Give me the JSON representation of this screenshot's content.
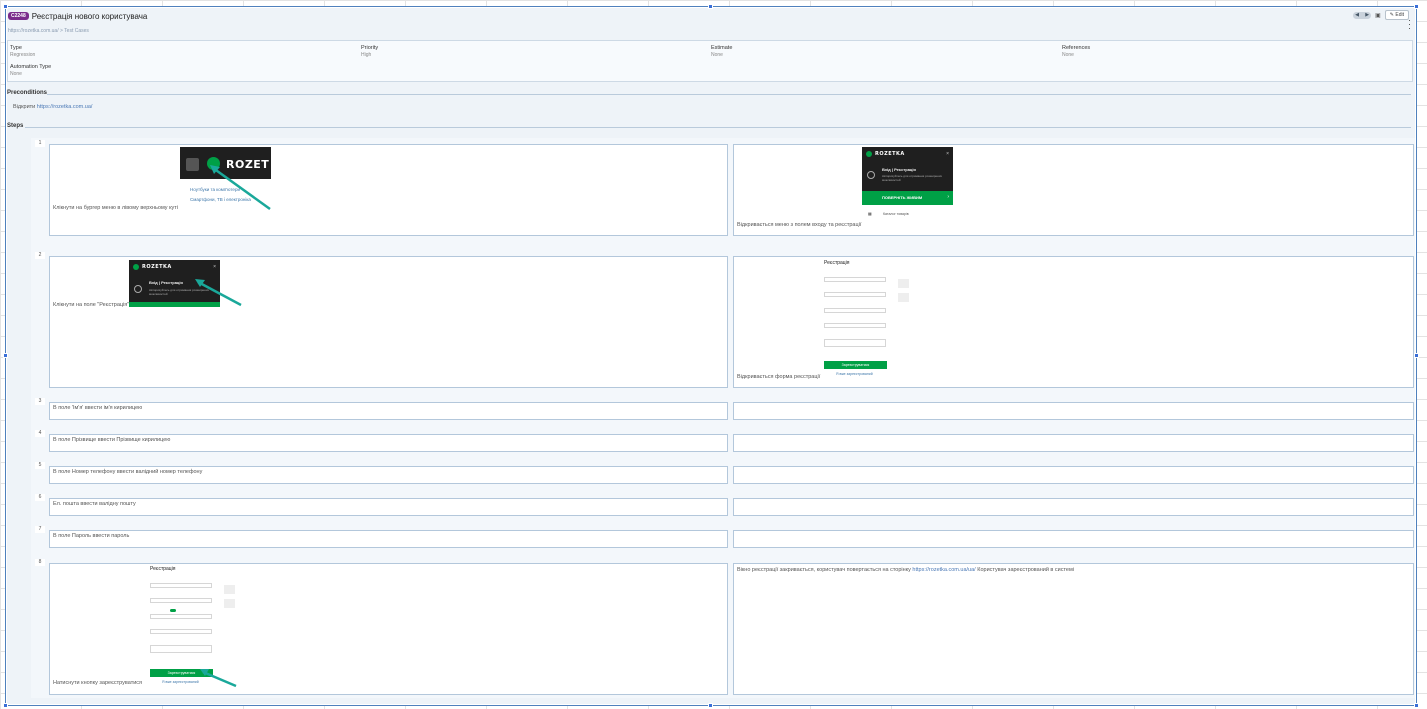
{
  "header": {
    "case_id": "C2248",
    "title": "Реєстрація нового користувача",
    "edit_label": "Edit"
  },
  "breadcrumb": "https://rozetka.com.ua/ > Test Cases",
  "fields": {
    "type_label": "Type",
    "type_value": "Regression",
    "priority_label": "Priority",
    "priority_value": "High",
    "estimate_label": "Estimate",
    "estimate_value": "None",
    "references_label": "References",
    "references_value": "None",
    "automation_label": "Automation Type",
    "automation_value": "None"
  },
  "preconditions": {
    "label": "Preconditions",
    "text": "Відкрити",
    "link": "https://rozetka.com.ua/"
  },
  "steps_label": "Steps",
  "steps": [
    {
      "num": "1",
      "action": "Клікнути на бургер меню в лівому верхньому куті",
      "expected": "Відкривається меню з полем входу та реєстрації"
    },
    {
      "num": "2",
      "action": "Клікнути на поле \"Реєстрація\"",
      "expected": "Відкривається форма реєстрації"
    },
    {
      "num": "3",
      "action": "В поле 'Ім'я' ввести ім'я кирилицею",
      "expected": ""
    },
    {
      "num": "4",
      "action": "В поле Прізвище ввести Прізвище кирилицею",
      "expected": ""
    },
    {
      "num": "5",
      "action": "В поле Номер телефону ввести валідний номер телефону",
      "expected": ""
    },
    {
      "num": "6",
      "action": "Ел. пошта ввести валідну пошту",
      "expected": ""
    },
    {
      "num": "7",
      "action": "В поле Пароль ввести пароль",
      "expected": ""
    },
    {
      "num": "8",
      "action": "Натиснути кнопку зареєструватися",
      "expected_pre": "Вікно реєстрації закривається, користувач повертається на сторінку",
      "expected_link": "https://rozetka.com.ua/ua/",
      "expected_post": "Користувач зареєстрований в системі"
    }
  ],
  "thumbs": {
    "logo": "ROZETKA",
    "logo_short": "ROZET",
    "menu_links": [
      "Ноутбуки та комп'ютери",
      "Смартфони, ТВ і електроніка"
    ],
    "menu_login": "Вхід",
    "menu_register": "Реєстрація",
    "menu_sub": "Авторизуйтесь для отримання розширених можливостей",
    "menu_green": "ПОВЕРНІТЬ ЖИВИМ",
    "menu_catalog": "Каталог товарів",
    "form_title": "Реєстрація",
    "form_submit": "Зареєструватися",
    "form_login": "Я вже зареєстрований"
  },
  "colors": {
    "accent": "#00a046",
    "case_badge": "#7a2c8c",
    "frame": "#4f81bd"
  }
}
